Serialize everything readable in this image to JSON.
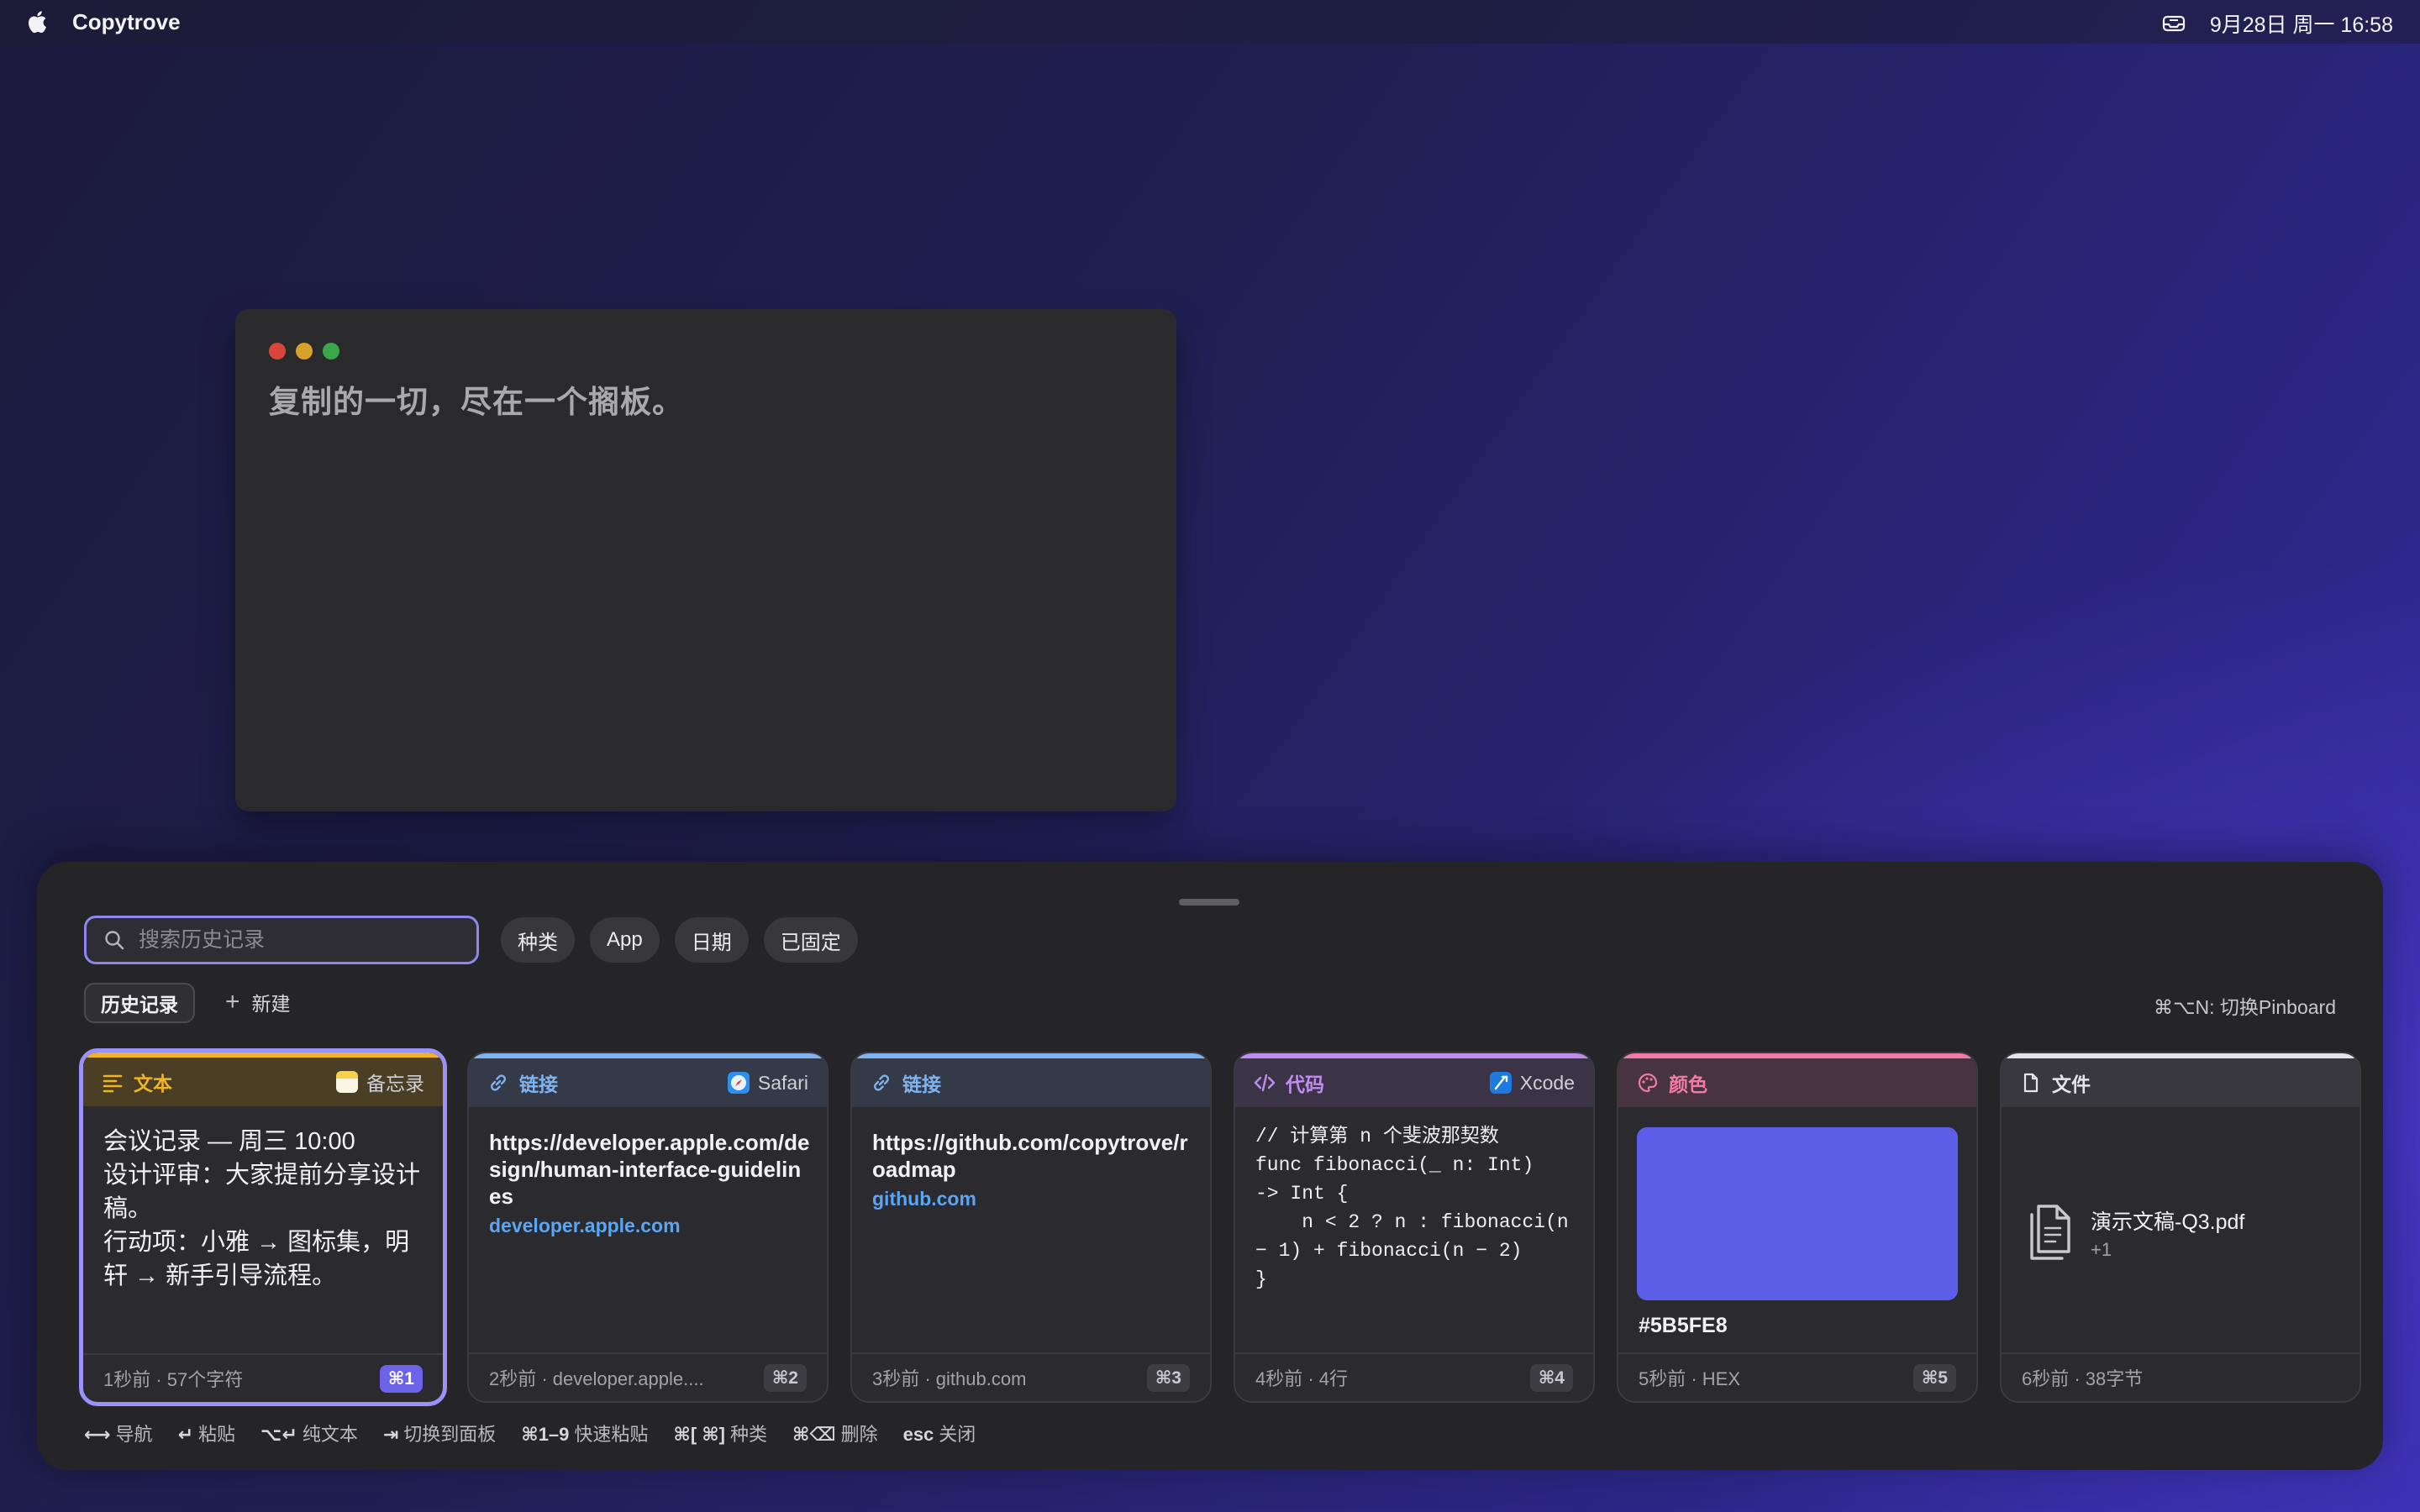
{
  "menubar": {
    "app_name": "Copytrove",
    "datetime": "9月28日 周一 16:58",
    "icons": [
      "apple-logo",
      "pinboard-tray-icon"
    ]
  },
  "background_window": {
    "text": "复制的一切，尽在一个搁板。"
  },
  "panel": {
    "search": {
      "placeholder": "搜索历史记录",
      "value": ""
    },
    "filters": [
      "种类",
      "App",
      "日期",
      "已固定"
    ],
    "tab_history": "历史记录",
    "new_label": "新建",
    "pinboard_shortcut": "⌘⌥N: 切换Pinboard",
    "cards": [
      {
        "type": "文本",
        "source": "备忘录",
        "type_color": "#f0b429",
        "head_bg": "#4a3f24",
        "content": "会议记录 — 周三 10:00\n设计评审：大家提前分享设计稿。\n行动项：小雅 → 图标集，明轩 → 新手引导流程。",
        "meta": "1秒前 · 57个字符",
        "shortcut": "⌘1",
        "selected": true
      },
      {
        "type": "链接",
        "source": "Safari",
        "type_color": "#7fb3f0",
        "head_bg": "#343a47",
        "url": "https://developer.apple.com/design/human-interface-guidelines",
        "domain": "developer.apple.com",
        "meta": "2秒前 · developer.apple....",
        "shortcut": "⌘2"
      },
      {
        "type": "链接",
        "source": "",
        "type_color": "#7fb3f0",
        "head_bg": "#343a47",
        "url": "https://github.com/copytrove/roadmap",
        "domain": "github.com",
        "meta": "3秒前 · github.com",
        "shortcut": "⌘3"
      },
      {
        "type": "代码",
        "source": "Xcode",
        "type_color": "#c08cf0",
        "head_bg": "#3b3447",
        "code": "// 计算第 n 个斐波那契数\nfunc fibonacci(_ n: Int)\n-> Int {\n    n < 2 ? n : fibonacci(n\n− 1) + fibonacci(n − 2)\n}",
        "meta": "4秒前 · 4行",
        "shortcut": "⌘4"
      },
      {
        "type": "颜色",
        "source": "",
        "type_color": "#f27aa6",
        "head_bg": "#473440",
        "color_value": "#5B5FE8",
        "swatch": "#5B5FE8",
        "meta": "5秒前 · HEX",
        "shortcut": "⌘5"
      },
      {
        "type": "文件",
        "source": "",
        "type_color": "#e4e4ea",
        "head_bg": "#38383e",
        "file_name": "演示文稿-Q3.pdf",
        "file_more": "+1",
        "meta": "6秒前 · 38字节",
        "shortcut": ""
      }
    ],
    "hints": [
      {
        "key": "⟷",
        "label": "导航"
      },
      {
        "key": "↵",
        "label": "粘贴"
      },
      {
        "key": "⌥↵",
        "label": "纯文本"
      },
      {
        "key": "⇥",
        "label": "切换到面板"
      },
      {
        "key": "⌘1–9",
        "label": "快速粘贴"
      },
      {
        "key": "⌘[ ⌘]",
        "label": "种类"
      },
      {
        "key": "⌘⌫",
        "label": "删除"
      },
      {
        "key": "esc",
        "label": "关闭"
      }
    ]
  },
  "colors": {
    "accent": "#8f86ee",
    "shortcut_active": "#6d62ea",
    "link_domain": "#5aa6f2"
  }
}
